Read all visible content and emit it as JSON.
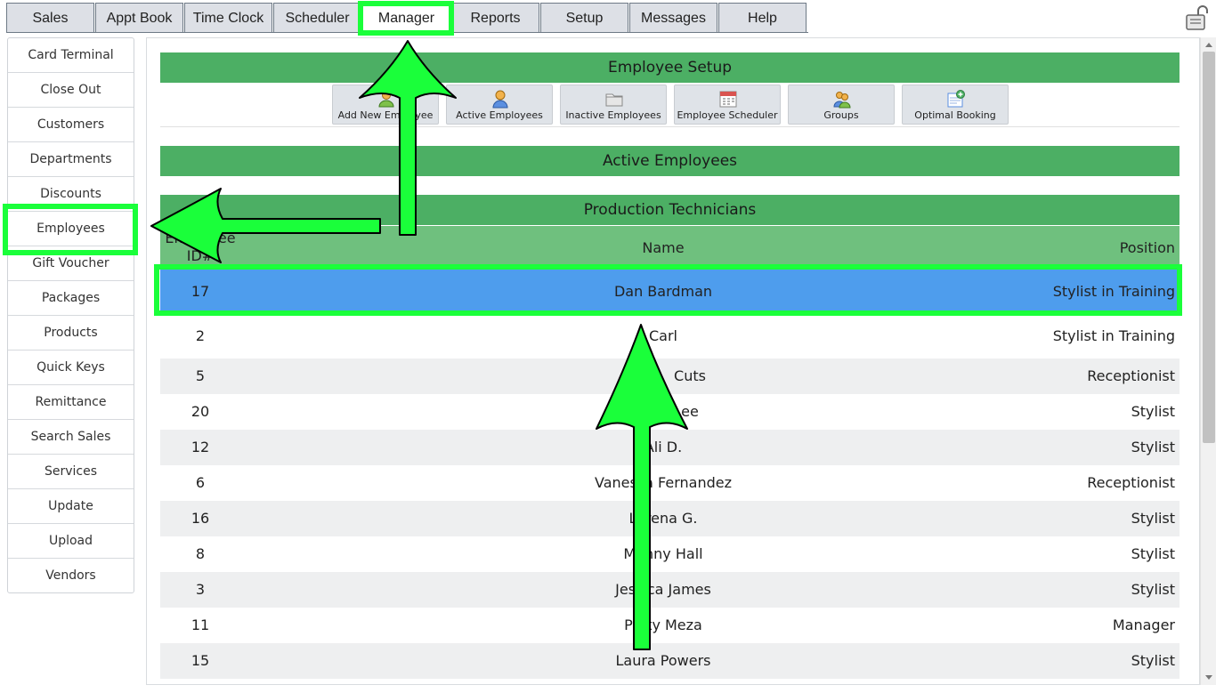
{
  "nav": {
    "tabs": [
      {
        "label": "Sales"
      },
      {
        "label": "Appt Book"
      },
      {
        "label": "Time Clock"
      },
      {
        "label": "Scheduler"
      },
      {
        "label": "Manager",
        "active": true
      },
      {
        "label": "Reports"
      },
      {
        "label": "Setup"
      },
      {
        "label": "Messages"
      },
      {
        "label": "Help"
      }
    ],
    "lock_icon": "lock-open-icon"
  },
  "sidebar": {
    "items": [
      "Card Terminal",
      "Close Out",
      "Customers",
      "Departments",
      "Discounts",
      "Employees",
      "Gift Voucher",
      "Packages",
      "Products",
      "Quick Keys",
      "Remittance",
      "Search Sales",
      "Services",
      "Update",
      "Upload",
      "Vendors"
    ],
    "selected": "Employees"
  },
  "employee_setup": {
    "title": "Employee Setup",
    "tools": [
      {
        "label": "Add New Employee",
        "icon": "add-employee-icon"
      },
      {
        "label": "Active Employees",
        "icon": "active-employees-icon"
      },
      {
        "label": "Inactive Employees",
        "icon": "folder-icon"
      },
      {
        "label": "Employee Scheduler",
        "icon": "calendar-icon"
      },
      {
        "label": "Groups",
        "icon": "groups-icon"
      },
      {
        "label": "Optimal Booking",
        "icon": "optimal-booking-icon"
      }
    ]
  },
  "active_employees": {
    "title": "Active Employees",
    "group_title": "Production Technicians",
    "columns": {
      "id": "Employee ID#",
      "name": "Name",
      "position": "Position"
    },
    "rows": [
      {
        "id": "17",
        "name": "Dan Bardman",
        "position": "Stylist in Training",
        "selected": true
      },
      {
        "id": "2",
        "name": "Carl",
        "position": "Stylist in Training"
      },
      {
        "id": "5",
        "name": "Cuts",
        "position": "Receptionist"
      },
      {
        "id": "20",
        "name": "ee",
        "position": "Stylist"
      },
      {
        "id": "12",
        "name": "Ali D.",
        "position": "Stylist"
      },
      {
        "id": "6",
        "name": "Vanessa Fernandez",
        "position": "Receptionist"
      },
      {
        "id": "16",
        "name": "Lorena G.",
        "position": "Stylist"
      },
      {
        "id": "8",
        "name": "Manny Hall",
        "position": "Stylist"
      },
      {
        "id": "3",
        "name": "Jessica James",
        "position": "Stylist"
      },
      {
        "id": "11",
        "name": "Patty Meza",
        "position": "Manager"
      },
      {
        "id": "15",
        "name": "Laura Powers",
        "position": "Stylist"
      }
    ]
  },
  "colors": {
    "header_green": "#4caf64",
    "column_header_green": "#6fc07e",
    "selected_row_blue": "#4e9ded",
    "annotation_green": "#1aff3a"
  }
}
